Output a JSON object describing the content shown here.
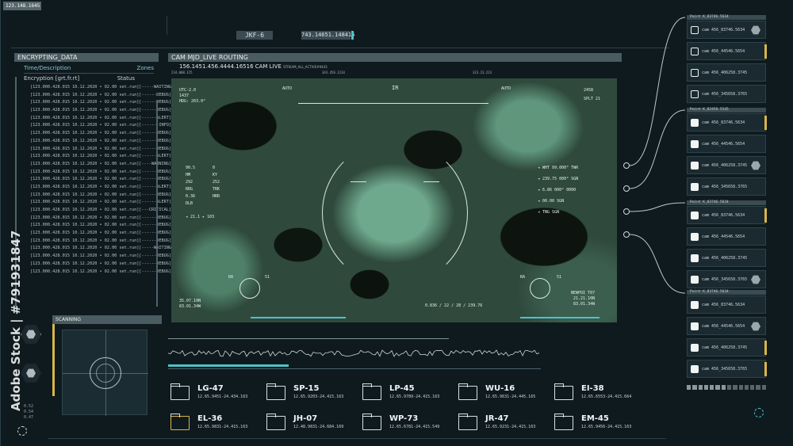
{
  "top_left_id": "123.148.1645",
  "top_tags": {
    "left": "JKF-6",
    "right": "743.14651.148415"
  },
  "encrypting": {
    "title": "ENCRYPTING_DATA",
    "col_time": "Time/Description",
    "col_zones": "Zones",
    "sub_left": "Encryption [grt.fr.rt]",
    "sub_right": "Status",
    "rows": [
      {
        "t": "[123.000.428.015 10.12.2020 • 02.00 set.run]",
        "s": "[-----WAITING]"
      },
      {
        "t": "[123.000.428.015 10.12.2020 • 02.00 set.run]",
        "s": "[------DEBUG]"
      },
      {
        "t": "[123.000.428.015 10.12.2020 • 02.00 set.run]",
        "s": "[------DEBUG]"
      },
      {
        "t": "[123.000.428.015 10.12.2020 • 02.00 set.run]",
        "s": "[------DEBUG]"
      },
      {
        "t": "[123.000.428.015 10.12.2020 • 02.00 set.run]",
        "s": "[------ALERT]"
      },
      {
        "t": "[123.000.428.015 10.12.2020 • 02.00 set.run]",
        "s": "[-------INFO]"
      },
      {
        "t": "[123.000.428.015 10.12.2020 • 02.00 set.run]",
        "s": "[------DEBUG]"
      },
      {
        "t": "[123.000.428.015 10.12.2020 • 02.00 set.run]",
        "s": "[------DEBUG]"
      },
      {
        "t": "[123.000.428.015 10.12.2020 • 02.00 set.run]",
        "s": "[------DEBUG]"
      },
      {
        "t": "[123.000.428.015 10.12.2020 • 02.00 set.run]",
        "s": "[------ALERT]"
      },
      {
        "t": "[123.000.428.015 10.12.2020 • 02.00 set.run]",
        "s": "[----WARNING]"
      },
      {
        "t": "[123.000.428.015 10.12.2020 • 02.00 set.run]",
        "s": "[------DEBUG]"
      },
      {
        "t": "[123.000.428.015 10.12.2020 • 02.00 set.run]",
        "s": "[------DEBUG]"
      },
      {
        "t": "[123.000.428.015 10.12.2020 • 02.00 set.run]",
        "s": "[------ALERT]"
      },
      {
        "t": "[123.000.428.015 10.12.2020 • 02.00 set.run]",
        "s": "[------DEBUG]"
      },
      {
        "t": "[123.000.428.015 10.12.2020 • 02.00 set.run]",
        "s": "[------ALERT]"
      },
      {
        "t": "[123.000.428.015 10.12.2020 • 02.00 set.run]",
        "s": "[---CRITICAL]"
      },
      {
        "t": "[123.000.428.015 10.12.2020 • 02.00 set.run]",
        "s": "[------DEBUG]"
      },
      {
        "t": "[123.000.428.015 10.12.2020 • 02.00 set.run]",
        "s": "[------DEBUG]"
      },
      {
        "t": "[123.000.428.015 10.12.2020 • 02.00 set.run]",
        "s": "[------DEBUG]"
      },
      {
        "t": "[123.000.428.015 10.12.2020 • 02.00 set.run]",
        "s": "[------DEBUG]"
      },
      {
        "t": "[123.000.428.015 10.12.2020 • 02.00 set.run]",
        "s": "[-----WAITING]"
      },
      {
        "t": "[123.000.428.015 10.12.2020 • 02.00 set.run]",
        "s": "[------DEBUG]"
      },
      {
        "t": "[123.000.428.015 10.12.2020 • 02.00 set.run]",
        "s": "[------DEBUG]"
      },
      {
        "t": "[123.000.428.015 10.12.2020 • 02.00 set.run]",
        "s": "[------DEBUG]"
      }
    ]
  },
  "camera": {
    "title": "CAM MJD_LIVE ROUTING",
    "stream_id": "156.1451.456.4444.16516 CAM LIVE",
    "stream_sub": "STREAM_ALL_ACTIVE#9443",
    "ruler": [
      "234.000.125",
      "343.456.1234",
      "323.23.223"
    ],
    "hud": {
      "top_left": [
        "UTC-2.0",
        "1437",
        "HDG: 203.0°"
      ],
      "auto_left": "AUTO",
      "ir": "IR",
      "auto_right": "AUTO",
      "top_right": [
        "2458",
        "SPLT 21"
      ],
      "left_grid": [
        "90.5",
        "0",
        "HM",
        "KY",
        "292",
        "252",
        "RRG",
        "TRK",
        "0.36",
        "HRR",
        "DLB"
      ],
      "left_bottom": "◂ 21.1 ▸ 103",
      "right_readouts": [
        "◂ WHT 99.000° TWR",
        "◂ 239.75 000° SGN",
        "◂ 6.86 000° 0000",
        "◂ 00.00 SGN",
        "◂ TNG SGN"
      ],
      "bottom_left": [
        "35.07.10N",
        "83.01.34W"
      ],
      "bottom_center": "0.836 / 22 / 28 / 239.76",
      "bottom_right": [
        "NEWPOI T07",
        "21.21.10N",
        "83.01.34W"
      ],
      "ret_left": [
        "RA",
        "51"
      ],
      "ret_right": [
        "RA",
        "51"
      ]
    }
  },
  "scanning": {
    "title": "SCANNING"
  },
  "vertical_watermark": "Adobe Stock | #791931847",
  "left_small_numbers": [
    "0.52",
    "0.54",
    "0.47"
  ],
  "targets": [
    {
      "code": "LG-47",
      "coord": "12.65.9451-24.434.163"
    },
    {
      "code": "SP-15",
      "coord": "12.65.9203-24.415.163"
    },
    {
      "code": "LP-45",
      "coord": "12.65.9789-24.415.163"
    },
    {
      "code": "WU-16",
      "coord": "12.65.9631-24.445.165"
    },
    {
      "code": "EI-38",
      "coord": "12.65.6553-24.415.664"
    },
    {
      "code": "EL-36",
      "coord": "12.65.9831-24.415.163"
    },
    {
      "code": "JH-07",
      "coord": "12.48.9831-24.684.169"
    },
    {
      "code": "WP-73",
      "coord": "12.65.6781-24.415.549"
    },
    {
      "code": "JR-47",
      "coord": "12.65.9231-24.415.163"
    },
    {
      "code": "EM-45",
      "coord": "12.65.9456-24.415.163"
    }
  ],
  "right_groups": [
    {
      "head": "Point K_83746.5634",
      "items": [
        "cam 456_83746.5634",
        "cam 456_44546.5654",
        "cam 456_406258.3745",
        "cam 456_345658.3765"
      ]
    },
    {
      "head": "Point K_82458.5545",
      "items": [
        "cam 456_83746.5634",
        "cam 456_44546.5654",
        "cam 456_406258.3745",
        "cam 456_345658.3765"
      ]
    },
    {
      "head": "Point K_83746.5634",
      "items": [
        "cam 456_83746.5634",
        "cam 456_44546.5654",
        "cam 456_406258.3745",
        "cam 456_345658.3765"
      ]
    },
    {
      "head": "Point K_83746.5634",
      "items": [
        "cam 456_83746.5634",
        "cam 456_44546.5654",
        "cam 456_406258.3745",
        "cam 456_345658.3765"
      ]
    }
  ],
  "colors": {
    "accent": "#4fc3c7",
    "warn": "#d9b54a",
    "panel": "#4a5b61",
    "bg": "#0f1a1f"
  }
}
